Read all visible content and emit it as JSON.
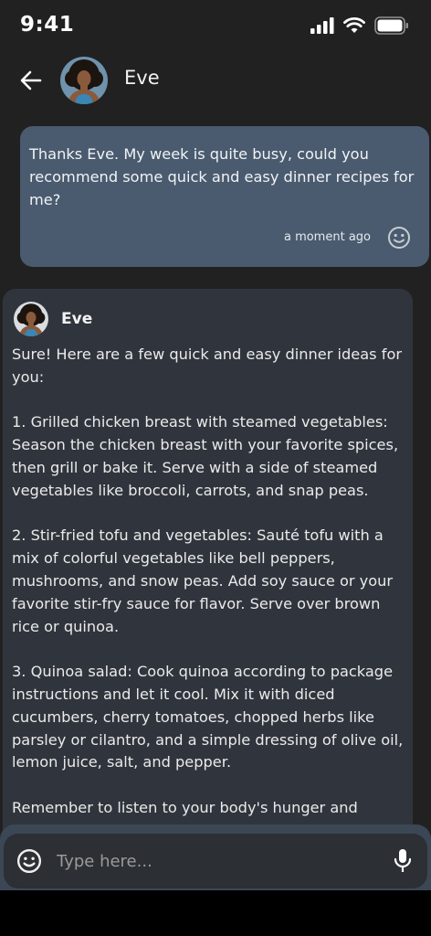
{
  "status_bar": {
    "time": "9:41",
    "icons": [
      "signal-icon",
      "wifi-icon",
      "battery-icon"
    ]
  },
  "header": {
    "back_icon": "arrow-left-icon",
    "contact_name": "Eve"
  },
  "messages": {
    "user": {
      "text": "Thanks Eve. My week is quite busy, could you\nrecommend some quick and easy dinner recipes for\nme?",
      "timestamp": "a moment ago",
      "reaction_icon": "smiley-icon"
    },
    "assistant": {
      "sender": "Eve",
      "text": "Sure! Here are a few quick and easy dinner ideas for\nyou:\n\n1. Grilled chicken breast with steamed vegetables:\nSeason the chicken breast with your favorite spices,\nthen grill or bake it. Serve with a side of steamed\nvegetables like broccoli, carrots, and snap peas.\n\n2. Stir-fried tofu and vegetables: Sauté tofu with a\nmix of colorful vegetables like bell peppers,\nmushrooms, and snow peas. Add soy sauce or your\nfavorite stir-fry sauce for flavor. Serve over brown\nrice or quinoa.\n\n3. Quinoa salad: Cook quinoa according to package\ninstructions and let it cool. Mix it with diced\ncucumbers, cherry tomatoes, chopped herbs like\nparsley or cilantro, and a simple dressing of olive oil,\nlemon juice, salt, and pepper.\n\nRemember to listen to your body's hunger and"
    }
  },
  "composer": {
    "placeholder": "Type here...",
    "emoji_icon": "smiley-icon",
    "mic_icon": "microphone-icon"
  },
  "colors": {
    "background": "#212121",
    "user_bubble": "#4a5b6f",
    "assistant_bubble": "#30353d",
    "composer_bar": "#2c2f33"
  }
}
